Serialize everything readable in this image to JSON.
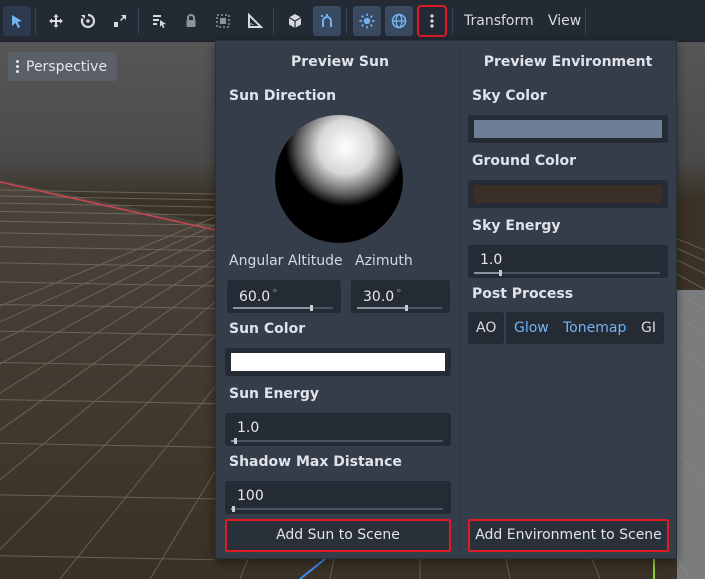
{
  "toolbar": {
    "menus": [
      "Transform",
      "View"
    ],
    "icons": [
      "select-icon",
      "move-icon",
      "rotate-icon",
      "scale-icon",
      "list-select-icon",
      "lock-icon",
      "group-icon",
      "ruler-icon",
      "local-space-icon",
      "snap-icon",
      "sun-icon",
      "environment-icon",
      "more-options-icon"
    ]
  },
  "viewport": {
    "perspective_label": "Perspective"
  },
  "preview_sun": {
    "title": "Preview Sun",
    "sun_direction_label": "Sun Direction",
    "angular_altitude_label": "Angular Altitude",
    "azimuth_label": "Azimuth",
    "angular_altitude_value": "60.0",
    "angular_altitude_fraction": 0.78,
    "azimuth_value": "30.0",
    "azimuth_fraction": 0.58,
    "degree_unit": "°",
    "sun_color_label": "Sun Color",
    "sun_color": "#ffffff",
    "sun_energy_label": "Sun Energy",
    "sun_energy_value": "1.0",
    "sun_energy_fraction": 0.02,
    "shadow_max_distance_label": "Shadow Max Distance",
    "shadow_max_distance_value": "100",
    "shadow_max_distance_fraction": 0.01,
    "add_button": "Add Sun to Scene"
  },
  "preview_environment": {
    "title": "Preview Environment",
    "sky_color_label": "Sky Color",
    "sky_color": "#6e7f95",
    "ground_color_label": "Ground Color",
    "ground_color": "#3a2f26",
    "sky_energy_label": "Sky Energy",
    "sky_energy_value": "1.0",
    "sky_energy_fraction": 0.14,
    "post_process_label": "Post Process",
    "post_process": [
      {
        "label": "AO",
        "on": false
      },
      {
        "label": "Glow",
        "on": true
      },
      {
        "label": "Tonemap",
        "on": true
      },
      {
        "label": "GI",
        "on": false
      }
    ],
    "add_button": "Add Environment to Scene"
  }
}
